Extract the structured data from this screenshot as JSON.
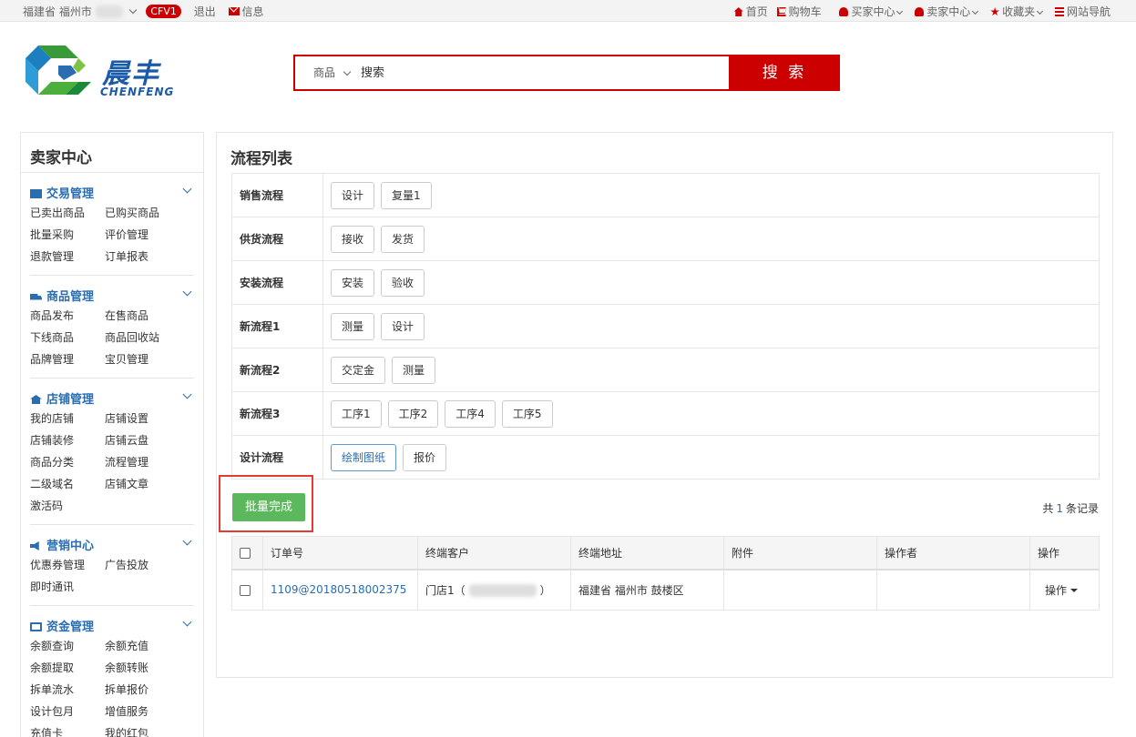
{
  "topbar": {
    "province": "福建省",
    "city": "福州市",
    "badge": "CFV1",
    "logout": "退出",
    "message": "信息",
    "right_links": [
      "首页",
      "购物车",
      "买家中心",
      "卖家中心",
      "收藏夹",
      "网站导航"
    ]
  },
  "logo": {
    "name": "晨丰",
    "pinyin": "CHENFENG"
  },
  "search": {
    "category": "商品",
    "placeholder": "搜索",
    "button": "搜 索"
  },
  "sidebar": {
    "title": "卖家中心",
    "groups": [
      {
        "title": "交易管理",
        "items": [
          "已卖出商品",
          "已购买商品",
          "批量采购",
          "评价管理",
          "退款管理",
          "订单报表"
        ]
      },
      {
        "title": "商品管理",
        "items": [
          "商品发布",
          "在售商品",
          "下线商品",
          "商品回收站",
          "品牌管理",
          "宝贝管理"
        ]
      },
      {
        "title": "店铺管理",
        "items": [
          "我的店铺",
          "店铺设置",
          "店铺装修",
          "店铺云盘",
          "商品分类",
          "流程管理",
          "二级域名",
          "店铺文章",
          "激活码"
        ]
      },
      {
        "title": "营销中心",
        "items": [
          "优惠券管理",
          "广告投放",
          "即时通讯"
        ]
      },
      {
        "title": "资金管理",
        "items": [
          "余额查询",
          "余额充值",
          "余额提取",
          "余额转账",
          "拆单流水",
          "拆单报价",
          "设计包月",
          "增值服务",
          "充值卡",
          "我的红包"
        ]
      }
    ]
  },
  "main": {
    "title": "流程列表",
    "flows": [
      {
        "name": "销售流程",
        "steps": [
          "设计",
          "复量1"
        ]
      },
      {
        "name": "供货流程",
        "steps": [
          "接收",
          "发货"
        ]
      },
      {
        "name": "安装流程",
        "steps": [
          "安装",
          "验收"
        ]
      },
      {
        "name": "新流程1",
        "steps": [
          "测量",
          "设计"
        ]
      },
      {
        "name": "新流程2",
        "steps": [
          "交定金",
          "测量"
        ]
      },
      {
        "name": "新流程3",
        "steps": [
          "工序1",
          "工序2",
          "工序4",
          "工序5"
        ]
      },
      {
        "name": "设计流程",
        "steps": [
          "绘制图纸",
          "报价"
        ],
        "active_step": "绘制图纸"
      }
    ],
    "batch_button": "批量完成",
    "record_prefix": "共",
    "record_count": "1",
    "record_suffix": "条记录",
    "columns": [
      "订单号",
      "终端客户",
      "终端地址",
      "附件",
      "操作者",
      "操作"
    ],
    "rows": [
      {
        "order_no": "1109@20180518002375",
        "customer_prefix": "门店1（",
        "customer_suffix": "）",
        "address": "福建省 福州市 鼓楼区",
        "attachment": "",
        "operator": "",
        "action": "操作"
      }
    ]
  },
  "colors": {
    "accent_red": "#cc0000",
    "link_blue": "#2a6db0",
    "success_green": "#5cb85c",
    "highlight_box": "#e53935"
  }
}
